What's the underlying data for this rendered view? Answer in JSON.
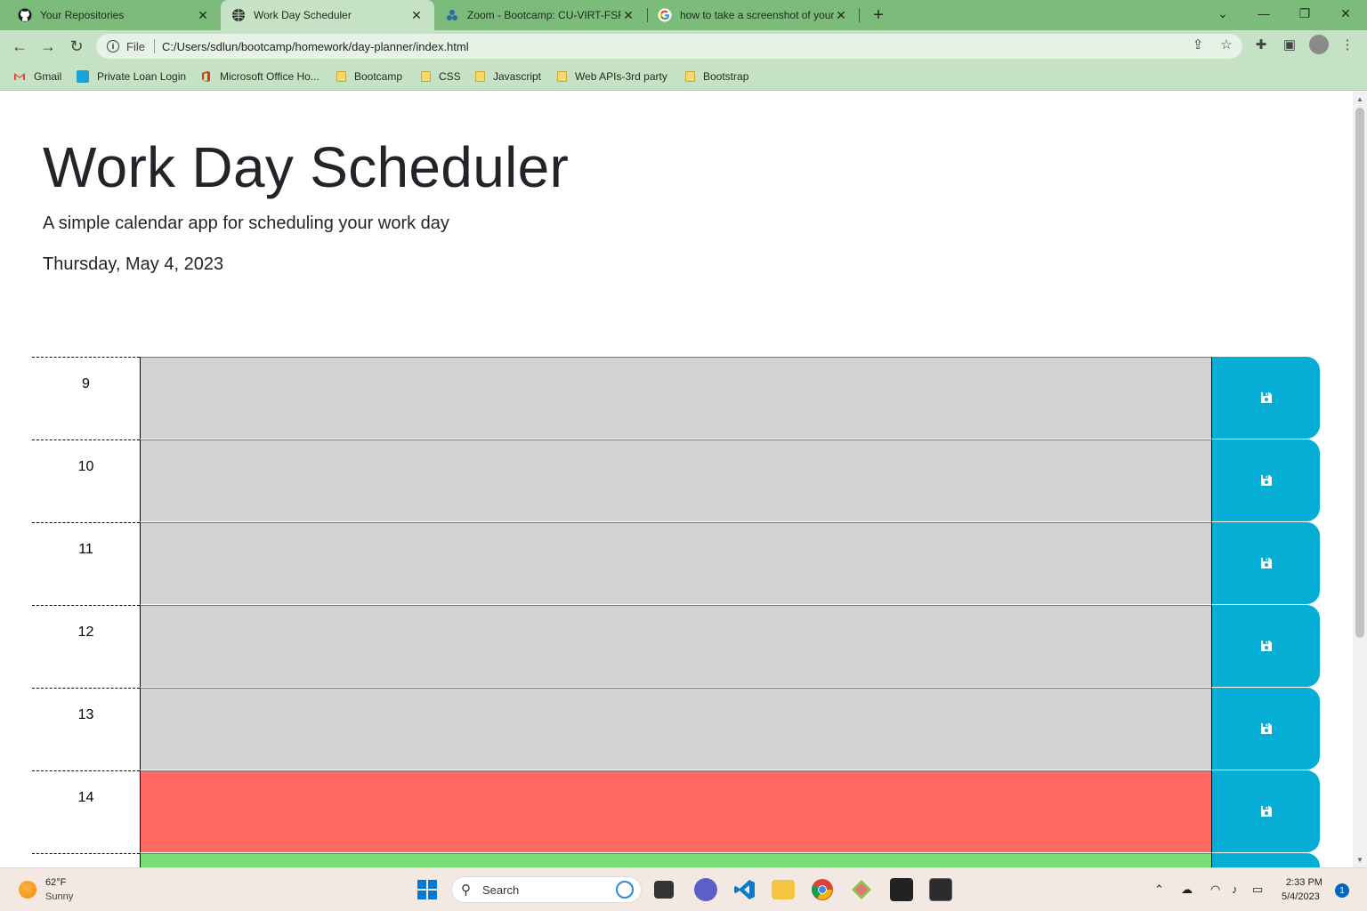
{
  "browser": {
    "tabs": [
      {
        "title": "Your Repositories",
        "icon": "github-icon"
      },
      {
        "title": "Work Day Scheduler",
        "icon": "globe-icon",
        "active": true
      },
      {
        "title": "Zoom - Bootcamp: CU-VIRT-FSF-",
        "icon": "zoom-icon"
      },
      {
        "title": "how to take a screenshot of your",
        "icon": "google-icon"
      }
    ],
    "address": {
      "scheme": "File",
      "url": "C:/Users/sdlun/bootcamp/homework/day-planner/index.html"
    },
    "bookmarks": [
      {
        "label": "Gmail",
        "icon": "gmail-icon"
      },
      {
        "label": "Private Loan Login",
        "icon": "bank-icon"
      },
      {
        "label": "Microsoft Office Ho...",
        "icon": "office-icon"
      },
      {
        "label": "Bootcamp",
        "icon": "folder-icon"
      },
      {
        "label": "CSS",
        "icon": "folder-icon"
      },
      {
        "label": "Javascript",
        "icon": "folder-icon"
      },
      {
        "label": "Web APIs-3rd party",
        "icon": "folder-icon"
      },
      {
        "label": "Bootstrap",
        "icon": "folder-icon"
      }
    ]
  },
  "page": {
    "title": "Work Day Scheduler",
    "lead": "A simple calendar app for scheduling your work day",
    "current_day": "Thursday, May 4, 2023"
  },
  "schedule": {
    "hours": [
      {
        "hour": "9",
        "state": "past",
        "text": ""
      },
      {
        "hour": "10",
        "state": "past",
        "text": ""
      },
      {
        "hour": "11",
        "state": "past",
        "text": ""
      },
      {
        "hour": "12",
        "state": "past",
        "text": ""
      },
      {
        "hour": "13",
        "state": "past",
        "text": ""
      },
      {
        "hour": "14",
        "state": "present",
        "text": ""
      },
      {
        "hour": "",
        "state": "future",
        "text": ""
      }
    ],
    "colors": {
      "past": "#d3d3d3",
      "present": "#ff6961",
      "future": "#77dd77",
      "save": "#06aed5"
    }
  },
  "taskbar": {
    "weather_temp": "62°F",
    "weather_desc": "Sunny",
    "search_placeholder": "Search",
    "time": "2:33 PM",
    "date": "5/4/2023",
    "notifications": "1"
  }
}
